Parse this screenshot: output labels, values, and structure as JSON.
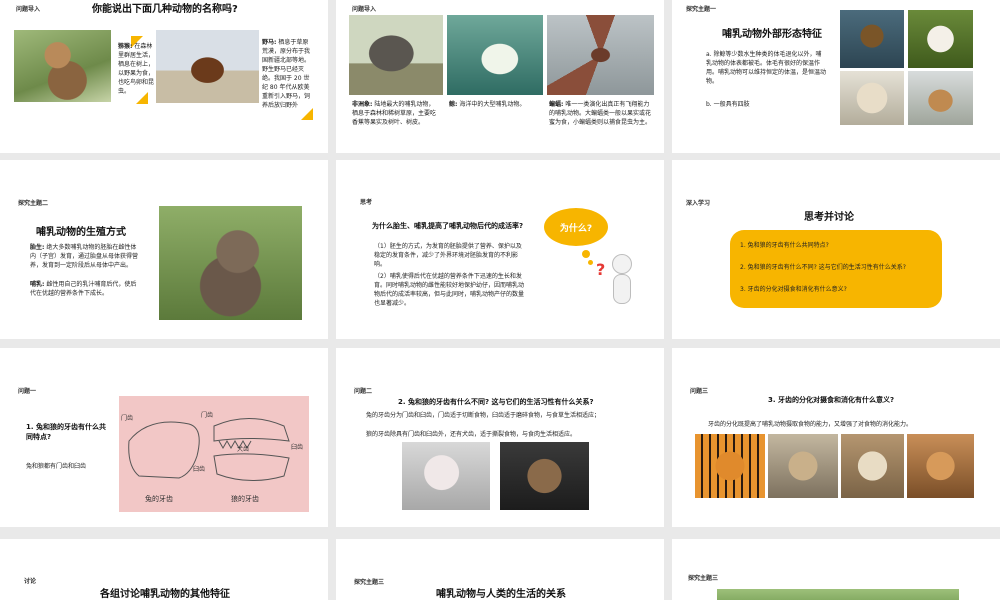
{
  "slides": [
    {
      "tag": "问题导入",
      "title": "你能说出下面几种动物的名称吗?",
      "monkey_label": "猕猴:",
      "monkey_text": "在森林里群居生活，栖息在树上，以野果为食，也吃鸟卵和昆虫。",
      "horse_label": "野马:",
      "horse_text": "栖息于草原荒漠，原分布于我国新疆北部等地。野生野马已经灭绝。我国于 20 世纪 80 年代从欧美重新引入野马，饲养后放归野外"
    },
    {
      "tag": "问题导入",
      "elephant_label": "非洲象:",
      "elephant_text": "陆地最大的哺乳动物，栖息于森林和稀树草原，主要吃香蕉等果实及树叶、树皮。",
      "whale_label": "鲸:",
      "whale_text": "海洋中的大型哺乳动物。",
      "bat_label": "蝙蝠:",
      "bat_text": "唯一一类演化出真正有飞翔能力的哺乳动物。大蝙蝠类一般以果实或花蜜为食，小蝙蝠类则以捕食昆虫为主。"
    },
    {
      "tag": "探究主题一",
      "title": "哺乳动物外部形态特征",
      "text_a": "a. 除鲸等少数水生种类的体毛退化以外，哺乳动物的体表都被毛。体毛有很好的保温作用。哺乳动物可以维持恒定的体温，是恒温动物。",
      "text_b": "b. 一般具有四肢"
    },
    {
      "tag": "探究主题二",
      "title": "哺乳动物的生殖方式",
      "birth_label": "胎生:",
      "birth_text": "绝大多数哺乳动物的胚胎在雌性体内（子宫）发育，通过胎盘从母体获得营养，发育到一定阶段后从母体中产出。",
      "nurse_label": "哺乳:",
      "nurse_text": "雌性用自己的乳汁哺育后代，使后代在优越的营养条件下成长。"
    },
    {
      "tag": "思考",
      "question": "为什么胎生、哺乳提高了哺乳动物后代的成活率?",
      "answer1": "（1）胚生的方式，为发育的胚胎提供了营养、保护以及稳定的发育条件，减少了外界环境对胚胎发育的不利影响。",
      "answer2": "（2）哺乳使得后代在优越的营养条件下迅速的生长和发育。同时哺乳动物的雌性能较好地保护幼仔，因而哺乳动物后代的成活率较高，但与此同时，哺乳动物产仔的数量也显著减少。",
      "bubble": "为什么?"
    },
    {
      "tag": "深入学习",
      "title": "思考并讨论",
      "items": [
        "1. 兔和狼的牙齿有什么共同特点?",
        "2. 兔和狼的牙齿有什么不同? 这与它们的生活习性有什么关系?",
        "3. 牙齿的分化对摄食和消化有什么意义?"
      ]
    },
    {
      "tag": "问题一",
      "question": "1. 兔和狼的牙齿有什么共同特点?",
      "answer": "兔和狼都有门齿和臼齿",
      "labels": {
        "incisor1": "门齿",
        "incisor2": "门齿",
        "molar1": "臼齿",
        "molar2": "臼齿",
        "canine": "犬齿"
      },
      "captions": {
        "rabbit": "兔的牙齿",
        "wolf": "狼的牙齿"
      }
    },
    {
      "tag": "问题二",
      "question": "2. 兔和狼的牙齿有什么不同? 这与它们的生活习性有什么关系?",
      "rabbit_text": "兔的牙齿分为门齿和臼齿，门齿适于切断食物，臼齿适于磨碎食物，与食草生活相适应；",
      "wolf_text": "狼的牙齿除具有门齿和臼齿外，还有犬齿，适于撕裂食物，与食肉生活相适应。"
    },
    {
      "tag": "问题三",
      "question": "3. 牙齿的分化对摄食和消化有什么意义?",
      "answer": "牙齿的分化既提高了哺乳动物摄取食物的能力，又增强了对食物的消化能力。"
    },
    {
      "tag": "讨论",
      "title": "各组讨论哺乳动物的其他特征"
    },
    {
      "tag": "探究主题三",
      "title": "哺乳动物与人类的生活的关系"
    },
    {
      "tag": "探究主题三"
    }
  ],
  "colors": {
    "accent": "#f7b500",
    "question_mark": "#e53935",
    "teeth_bg": "#f2c7c6"
  }
}
